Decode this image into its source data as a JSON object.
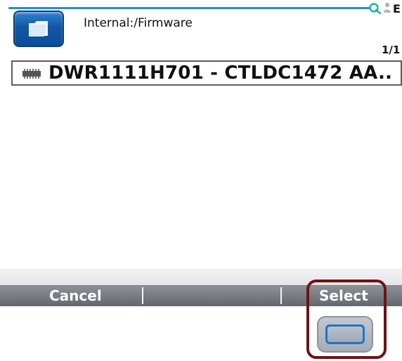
{
  "header": {
    "path": "Internal:/Firmware",
    "cut_char": "E"
  },
  "list": {
    "page_indicator": "1/1",
    "items": [
      {
        "label": "DWR1111H701 - CTLDC1472 AA.."
      }
    ]
  },
  "softkeys": {
    "left_label": "Cancel",
    "right_label": "Select"
  },
  "icons": {
    "folder": "folder-icon",
    "loop": "loop-icon",
    "person": "person-icon",
    "chip": "chip-icon",
    "hardkey": "hardware-key"
  },
  "colors": {
    "accent_blue": "#1f8fd2",
    "folder_blue": "#1157a5",
    "softkey_gray": "#6b7078",
    "highlight_red": "#6d1313"
  }
}
